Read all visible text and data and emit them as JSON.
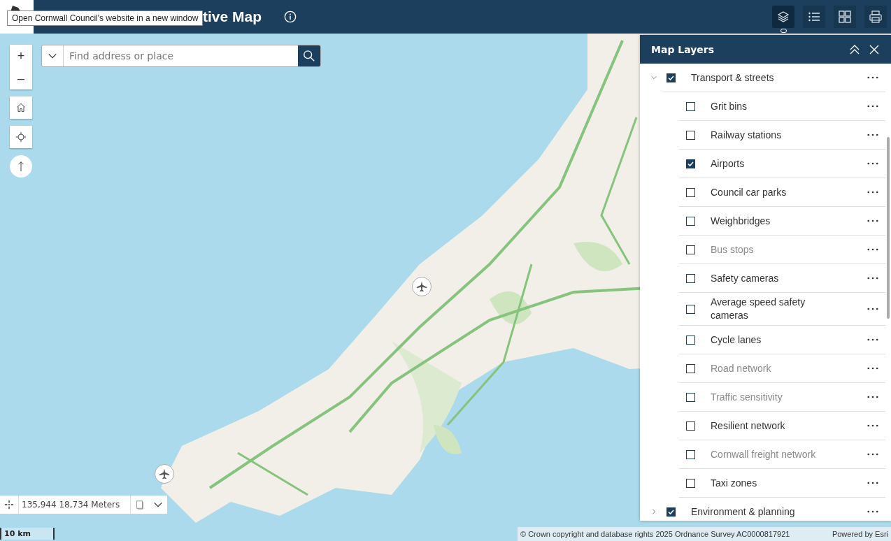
{
  "header": {
    "title": "tive Map",
    "tooltip": "Open Cornwall Council's website in a new window"
  },
  "toolbar": [
    {
      "kind": "layers",
      "selected": true
    },
    {
      "kind": "legend",
      "selected": false
    },
    {
      "kind": "basemap",
      "selected": false
    },
    {
      "kind": "print",
      "selected": false
    }
  ],
  "search": {
    "placeholder": "Find address or place"
  },
  "zoom_controls": [
    "+",
    "–"
  ],
  "coordinates": {
    "value": "135,944 18,734 Meters"
  },
  "scale_bar": "10 km",
  "attribution": {
    "text": "© Crown copyright and database rights 2025 Ordnance Survey AC0000817921",
    "powered_by": "Powered by Esri"
  },
  "layers_panel": {
    "title": "Map Layers",
    "groups": [
      {
        "label": "Transport & streets",
        "checked": true,
        "expanded": true,
        "children": [
          {
            "label": "Grit bins",
            "checked": false,
            "disabled": false
          },
          {
            "label": "Railway stations",
            "checked": false,
            "disabled": false
          },
          {
            "label": "Airports",
            "checked": true,
            "disabled": false
          },
          {
            "label": "Council car parks",
            "checked": false,
            "disabled": false
          },
          {
            "label": "Weighbridges",
            "checked": false,
            "disabled": false
          },
          {
            "label": "Bus stops",
            "checked": false,
            "disabled": true
          },
          {
            "label": "Safety cameras",
            "checked": false,
            "disabled": false
          },
          {
            "label": "Average speed safety cameras",
            "checked": false,
            "disabled": false
          },
          {
            "label": "Cycle lanes",
            "checked": false,
            "disabled": false
          },
          {
            "label": "Road network",
            "checked": false,
            "disabled": true
          },
          {
            "label": "Traffic sensitivity",
            "checked": false,
            "disabled": true
          },
          {
            "label": "Resilient network",
            "checked": false,
            "disabled": false
          },
          {
            "label": "Cornwall freight network",
            "checked": false,
            "disabled": true
          },
          {
            "label": "Taxi zones",
            "checked": false,
            "disabled": false
          }
        ]
      },
      {
        "label": "Environment & planning",
        "checked": true,
        "expanded": false
      }
    ]
  }
}
